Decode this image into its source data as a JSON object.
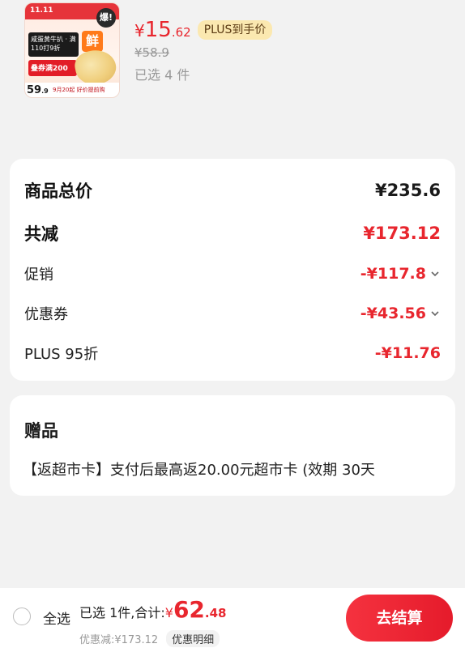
{
  "product": {
    "image_icon": "product-thumbnail",
    "image_text": {
      "banner": "11.11",
      "tag": "咸蛋黄牛扒 · 满110打9折",
      "promo": "叠券满200",
      "fresh": "鲜",
      "bao": "爆!",
      "bottom": "9月20起 好价提前购",
      "corner_int": "59",
      "corner_dec": ".9"
    },
    "price_symbol": "¥",
    "price_int": "15",
    "price_dec": ".62",
    "plus_tag": "PLUS到手价",
    "original_price": "¥58.9",
    "selected_qty": "已选 4 件"
  },
  "summary": {
    "total_label": "商品总价",
    "total_value": "¥235.6",
    "reduce_label": "共减",
    "reduce_value": "¥173.12",
    "promo_label": "促销",
    "promo_value": "-¥117.8",
    "coupon_label": "优惠券",
    "coupon_value": "-¥43.56",
    "plus_label": "PLUS 95折",
    "plus_value": "-¥11.76"
  },
  "gift": {
    "title": "赠品",
    "text": "【返超市卡】支付后最高返20.00元超市卡 (效期 30天"
  },
  "bottom_bar": {
    "select_all": "全选",
    "selected_prefix": "已选 1件,合计:",
    "total_symbol": "¥",
    "total_int": "62",
    "total_dec": ".48",
    "discount_text": "优惠减:¥173.12",
    "detail_label": "优惠明细",
    "checkout_label": "去结算"
  },
  "colors": {
    "accent_red": "#e8262e",
    "plus_tag_bg": "#fbe8b0",
    "background": "#f2f2f2"
  }
}
